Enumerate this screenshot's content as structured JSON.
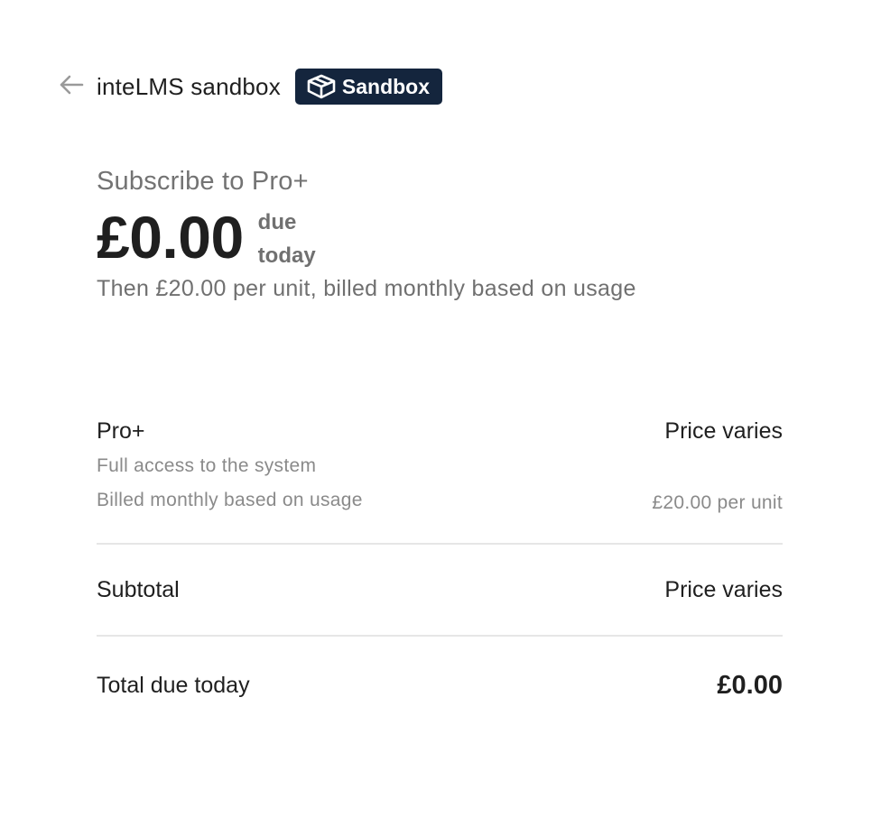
{
  "header": {
    "back_icon": "arrow-left-icon",
    "business_name": "inteLMS sandbox",
    "badge": {
      "icon": "cube-icon",
      "label": "Sandbox",
      "background": "#14253d"
    }
  },
  "summary": {
    "title": "Subscribe to Pro+",
    "amount": "£0.00",
    "due_line1": "due",
    "due_line2": "today",
    "then_text": "Then £20.00 per unit, billed monthly based on usage"
  },
  "line_item": {
    "name": "Pro+",
    "price": "Price varies",
    "description": "Full access to the system",
    "billing": "Billed monthly based on usage",
    "unit_price": "£20.00 per unit"
  },
  "subtotal": {
    "label": "Subtotal",
    "value": "Price varies"
  },
  "total": {
    "label": "Total due today",
    "value": "£0.00"
  }
}
